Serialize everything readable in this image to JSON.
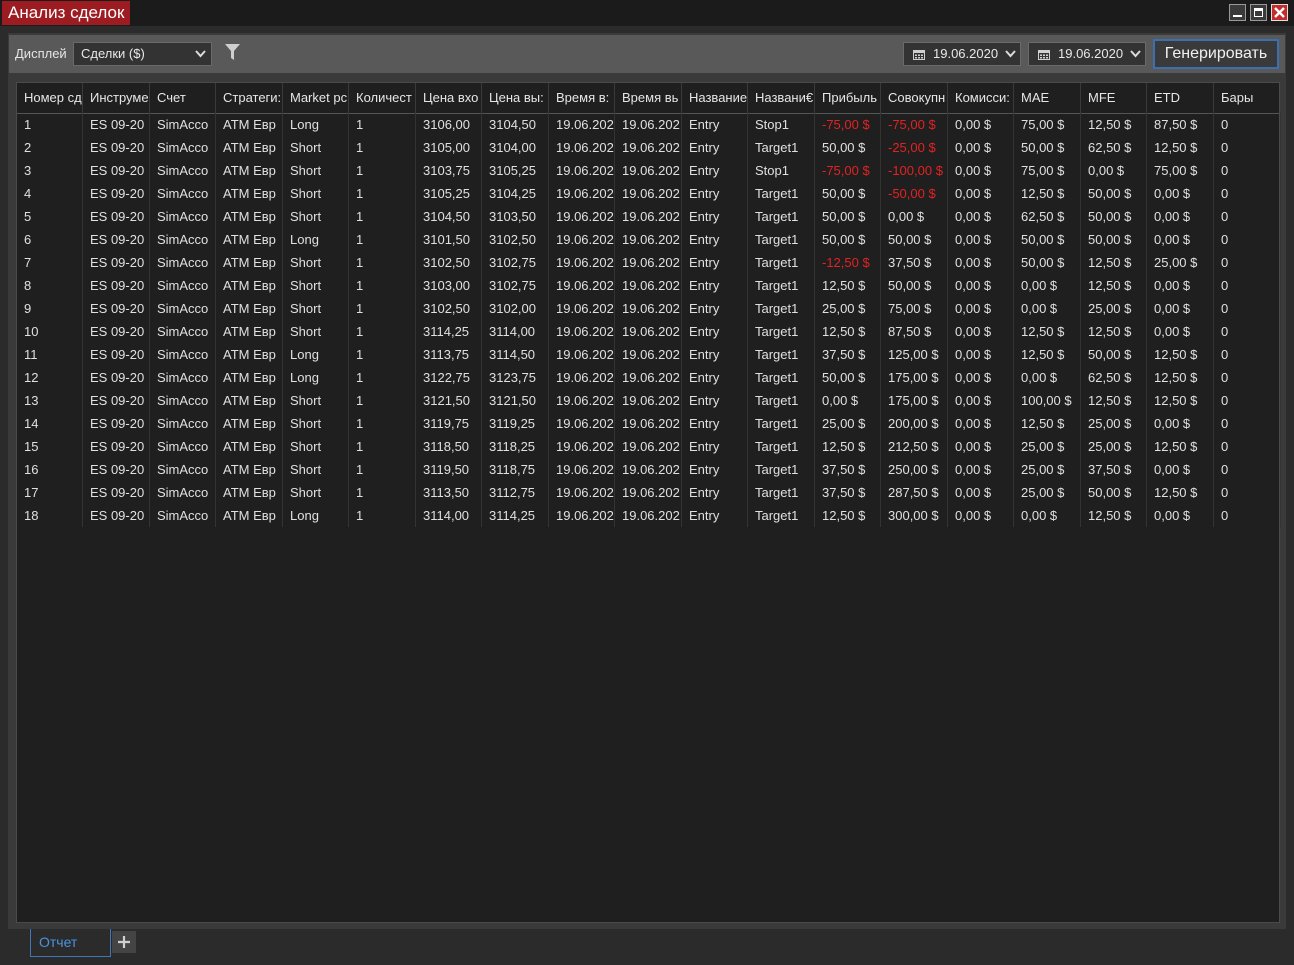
{
  "window": {
    "title": "Анализ сделок"
  },
  "toolbar": {
    "display_label": "Дисплей",
    "display_value": "Сделки ($)",
    "date_from": "19.06.2020",
    "date_to": "19.06.2020",
    "generate_label": "Генерировать"
  },
  "table": {
    "columns": [
      "Номер сд",
      "Инструме",
      "Счет",
      "Стратеги:",
      "Market pc",
      "Количест",
      "Цена вхо",
      "Цена вы:",
      "Время в:",
      "Время вь",
      "Название",
      "Названи€",
      "Прибыль",
      "Совокупн",
      "Комисси:",
      "MAE",
      "MFE",
      "ETD",
      "Бары"
    ],
    "rows": [
      [
        "1",
        "ES 09-20",
        "SimAcco",
        "ATM Евр",
        "Long",
        "1",
        "3106,00",
        "3104,50",
        "19.06.202",
        "19.06.202",
        "Entry",
        "Stop1",
        "-75,00 $",
        "-75,00 $",
        "0,00 $",
        "75,00 $",
        "12,50 $",
        "87,50 $",
        "0"
      ],
      [
        "2",
        "ES 09-20",
        "SimAcco",
        "ATM Евр",
        "Short",
        "1",
        "3105,00",
        "3104,00",
        "19.06.202",
        "19.06.202",
        "Entry",
        "Target1",
        "50,00 $",
        "-25,00 $",
        "0,00 $",
        "50,00 $",
        "62,50 $",
        "12,50 $",
        "0"
      ],
      [
        "3",
        "ES 09-20",
        "SimAcco",
        "ATM Евр",
        "Short",
        "1",
        "3103,75",
        "3105,25",
        "19.06.202",
        "19.06.202",
        "Entry",
        "Stop1",
        "-75,00 $",
        "-100,00 $",
        "0,00 $",
        "75,00 $",
        "0,00 $",
        "75,00 $",
        "0"
      ],
      [
        "4",
        "ES 09-20",
        "SimAcco",
        "ATM Евр",
        "Short",
        "1",
        "3105,25",
        "3104,25",
        "19.06.202",
        "19.06.202",
        "Entry",
        "Target1",
        "50,00 $",
        "-50,00 $",
        "0,00 $",
        "12,50 $",
        "50,00 $",
        "0,00 $",
        "0"
      ],
      [
        "5",
        "ES 09-20",
        "SimAcco",
        "ATM Евр",
        "Short",
        "1",
        "3104,50",
        "3103,50",
        "19.06.202",
        "19.06.202",
        "Entry",
        "Target1",
        "50,00 $",
        "0,00 $",
        "0,00 $",
        "62,50 $",
        "50,00 $",
        "0,00 $",
        "0"
      ],
      [
        "6",
        "ES 09-20",
        "SimAcco",
        "ATM Евр",
        "Long",
        "1",
        "3101,50",
        "3102,50",
        "19.06.202",
        "19.06.202",
        "Entry",
        "Target1",
        "50,00 $",
        "50,00 $",
        "0,00 $",
        "50,00 $",
        "50,00 $",
        "0,00 $",
        "0"
      ],
      [
        "7",
        "ES 09-20",
        "SimAcco",
        "ATM Евр",
        "Short",
        "1",
        "3102,50",
        "3102,75",
        "19.06.202",
        "19.06.202",
        "Entry",
        "Target1",
        "-12,50 $",
        "37,50 $",
        "0,00 $",
        "50,00 $",
        "12,50 $",
        "25,00 $",
        "0"
      ],
      [
        "8",
        "ES 09-20",
        "SimAcco",
        "ATM Евр",
        "Short",
        "1",
        "3103,00",
        "3102,75",
        "19.06.202",
        "19.06.202",
        "Entry",
        "Target1",
        "12,50 $",
        "50,00 $",
        "0,00 $",
        "0,00 $",
        "12,50 $",
        "0,00 $",
        "0"
      ],
      [
        "9",
        "ES 09-20",
        "SimAcco",
        "ATM Евр",
        "Short",
        "1",
        "3102,50",
        "3102,00",
        "19.06.202",
        "19.06.202",
        "Entry",
        "Target1",
        "25,00 $",
        "75,00 $",
        "0,00 $",
        "0,00 $",
        "25,00 $",
        "0,00 $",
        "0"
      ],
      [
        "10",
        "ES 09-20",
        "SimAcco",
        "ATM Евр",
        "Short",
        "1",
        "3114,25",
        "3114,00",
        "19.06.202",
        "19.06.202",
        "Entry",
        "Target1",
        "12,50 $",
        "87,50 $",
        "0,00 $",
        "12,50 $",
        "12,50 $",
        "0,00 $",
        "0"
      ],
      [
        "11",
        "ES 09-20",
        "SimAcco",
        "ATM Евр",
        "Long",
        "1",
        "3113,75",
        "3114,50",
        "19.06.202",
        "19.06.202",
        "Entry",
        "Target1",
        "37,50 $",
        "125,00 $",
        "0,00 $",
        "12,50 $",
        "50,00 $",
        "12,50 $",
        "0"
      ],
      [
        "12",
        "ES 09-20",
        "SimAcco",
        "ATM Евр",
        "Long",
        "1",
        "3122,75",
        "3123,75",
        "19.06.202",
        "19.06.202",
        "Entry",
        "Target1",
        "50,00 $",
        "175,00 $",
        "0,00 $",
        "0,00 $",
        "62,50 $",
        "12,50 $",
        "0"
      ],
      [
        "13",
        "ES 09-20",
        "SimAcco",
        "ATM Евр",
        "Short",
        "1",
        "3121,50",
        "3121,50",
        "19.06.202",
        "19.06.202",
        "Entry",
        "Target1",
        "0,00 $",
        "175,00 $",
        "0,00 $",
        "100,00 $",
        "12,50 $",
        "12,50 $",
        "0"
      ],
      [
        "14",
        "ES 09-20",
        "SimAcco",
        "ATM Евр",
        "Short",
        "1",
        "3119,75",
        "3119,25",
        "19.06.202",
        "19.06.202",
        "Entry",
        "Target1",
        "25,00 $",
        "200,00 $",
        "0,00 $",
        "12,50 $",
        "25,00 $",
        "0,00 $",
        "0"
      ],
      [
        "15",
        "ES 09-20",
        "SimAcco",
        "ATM Евр",
        "Short",
        "1",
        "3118,50",
        "3118,25",
        "19.06.202",
        "19.06.202",
        "Entry",
        "Target1",
        "12,50 $",
        "212,50 $",
        "0,00 $",
        "25,00 $",
        "25,00 $",
        "12,50 $",
        "0"
      ],
      [
        "16",
        "ES 09-20",
        "SimAcco",
        "ATM Евр",
        "Short",
        "1",
        "3119,50",
        "3118,75",
        "19.06.202",
        "19.06.202",
        "Entry",
        "Target1",
        "37,50 $",
        "250,00 $",
        "0,00 $",
        "25,00 $",
        "37,50 $",
        "0,00 $",
        "0"
      ],
      [
        "17",
        "ES 09-20",
        "SimAcco",
        "ATM Евр",
        "Short",
        "1",
        "3113,50",
        "3112,75",
        "19.06.202",
        "19.06.202",
        "Entry",
        "Target1",
        "37,50 $",
        "287,50 $",
        "0,00 $",
        "25,00 $",
        "50,00 $",
        "12,50 $",
        "0"
      ],
      [
        "18",
        "ES 09-20",
        "SimAcco",
        "ATM Евр",
        "Long",
        "1",
        "3114,00",
        "3114,25",
        "19.06.202",
        "19.06.202",
        "Entry",
        "Target1",
        "12,50 $",
        "300,00 $",
        "0,00 $",
        "0,00 $",
        "12,50 $",
        "0,00 $",
        "0"
      ]
    ]
  },
  "tabs": [
    {
      "label": "Отчет",
      "active": true
    }
  ],
  "icons": {
    "minimize": "minimize-icon",
    "maximize": "maximize-icon",
    "close": "close-icon",
    "filter": "filter-icon",
    "calendar": "calendar-icon",
    "dropdown": "chevron-down-icon",
    "add_tab": "plus-icon"
  },
  "colors": {
    "title_bg": "#9c1c22",
    "negative": "#e32222",
    "accent": "#3c6fb0",
    "tab_active": "#4a94e0"
  }
}
